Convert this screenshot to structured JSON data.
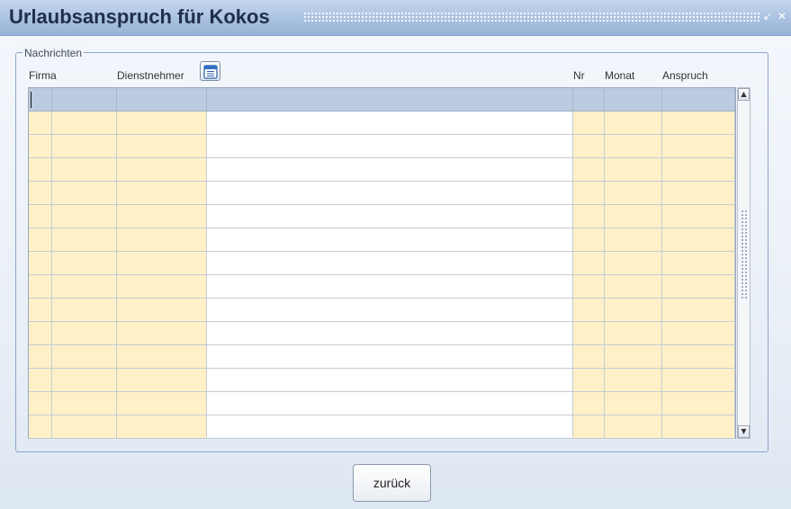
{
  "window": {
    "title": "Urlaubsanspruch für Kokos",
    "minimize_icon": "minimize-icon",
    "close_icon": "close-icon"
  },
  "group": {
    "legend": "Nachrichten"
  },
  "table": {
    "columns": [
      "Firma",
      "Dienstnehmer",
      "",
      "Nr",
      "Monat",
      "Anspruch"
    ],
    "calendar_icon": "calendar-icon",
    "header_row_values": [
      "",
      "",
      "",
      "",
      "",
      "",
      ""
    ],
    "row_count": 14
  },
  "colors": {
    "title_bar": "#a9c1e0",
    "readonly_cell": "#fff0c8",
    "editable_cell": "#ffffff",
    "header_row": "#bccbdf",
    "border": "#8ea6c8"
  },
  "buttons": {
    "back": "zurück"
  }
}
